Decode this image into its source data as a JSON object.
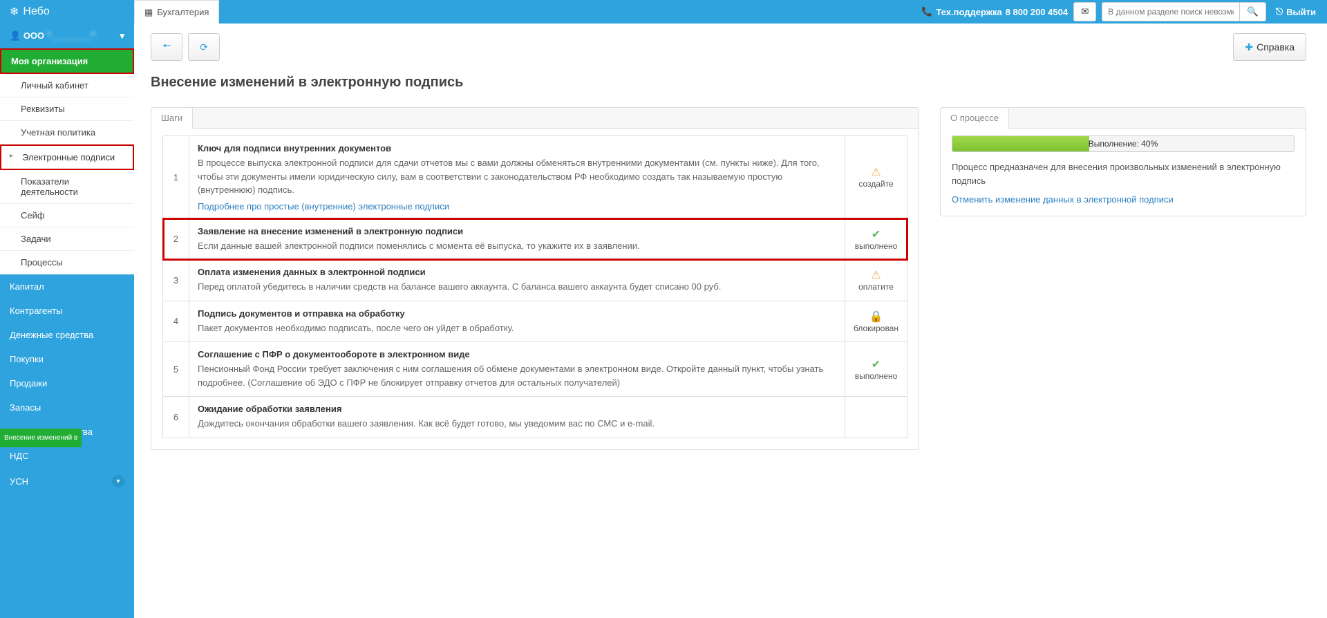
{
  "header": {
    "logo": "Небо",
    "tab": "Бухгалтерия",
    "support_label": "Тех.поддержка",
    "support_phone": "8 800 200 4504",
    "search_placeholder": "В данном разделе поиск невозможен",
    "exit": "Выйти"
  },
  "sidebar": {
    "org_prefix": "ООО",
    "org_name": "\"________\"",
    "active_section": "Моя организация",
    "sub_items": [
      "Личный кабинет",
      "Реквизиты",
      "Учетная политика",
      "Электронные подписи",
      "Показатели деятельности",
      "Сейф",
      "Задачи",
      "Процессы"
    ],
    "items": [
      "Капитал",
      "Контрагенты",
      "Денежные средства",
      "Покупки",
      "Продажи",
      "Запасы",
      "Основные средства",
      "НДС",
      "УСН"
    ],
    "tag": "Внесение изменений в"
  },
  "toolbar": {
    "help": "Справка"
  },
  "page": {
    "title": "Внесение изменений в электронную подпись",
    "steps_tab": "Шаги",
    "process_tab": "О процессе"
  },
  "steps": [
    {
      "num": "1",
      "title": "Ключ для подписи внутренних документов",
      "desc": "В процессе выпуска электронной подписи для сдачи отчетов мы с вами должны обменяться внутренними документами (см. пункты ниже). Для того, чтобы эти документы имели юридическую силу, вам в соответствии с законодательством РФ необходимо создать так называемую простую (внутреннюю) подпись.",
      "link": "Подробнее про простые (внутренние) электронные подписи",
      "status": "создайте",
      "icon": "warn"
    },
    {
      "num": "2",
      "title": "Заявление на внесение изменений в электронную подписи",
      "desc": "Если данные вашей электронной подписи поменялись с момента её выпуска, то укажите их в заявлении.",
      "status": "выполнено",
      "icon": "ok",
      "highlight": true
    },
    {
      "num": "3",
      "title": "Оплата изменения данных в электронной подписи",
      "desc": "Перед оплатой убедитесь в наличии средств на балансе вашего аккаунта. С баланса вашего аккаунта будет списано 00 руб.",
      "status": "оплатите",
      "icon": "warn"
    },
    {
      "num": "4",
      "title": "Подпись документов и отправка на обработку",
      "desc": "Пакет документов необходимо подписать, после чего он уйдет в обработку.",
      "status": "блокирован",
      "icon": "lock"
    },
    {
      "num": "5",
      "title": "Соглашение с ПФР о документообороте в электронном виде",
      "desc": "Пенсионный Фонд России требует заключения с ним соглашения об обмене документами в электронном виде. Откройте данный пункт, чтобы узнать подробнее. (Соглашение об ЭДО с ПФР не блокирует отправку отчетов для остальных получателей)",
      "status": "выполнено",
      "icon": "ok"
    },
    {
      "num": "6",
      "title": "Ожидание обработки заявления",
      "desc": "Дождитесь окончания обработки вашего заявления. Как всё будет готово, мы уведомим вас по СМС и e-mail.",
      "status": "",
      "icon": ""
    }
  ],
  "process": {
    "progress_pct": 40,
    "progress_label": "Выполнение: 40%",
    "desc": "Процесс предназначен для внесения произвольных изменений в электронную подпись",
    "cancel_link": "Отменить изменение данных в электронной подписи"
  }
}
